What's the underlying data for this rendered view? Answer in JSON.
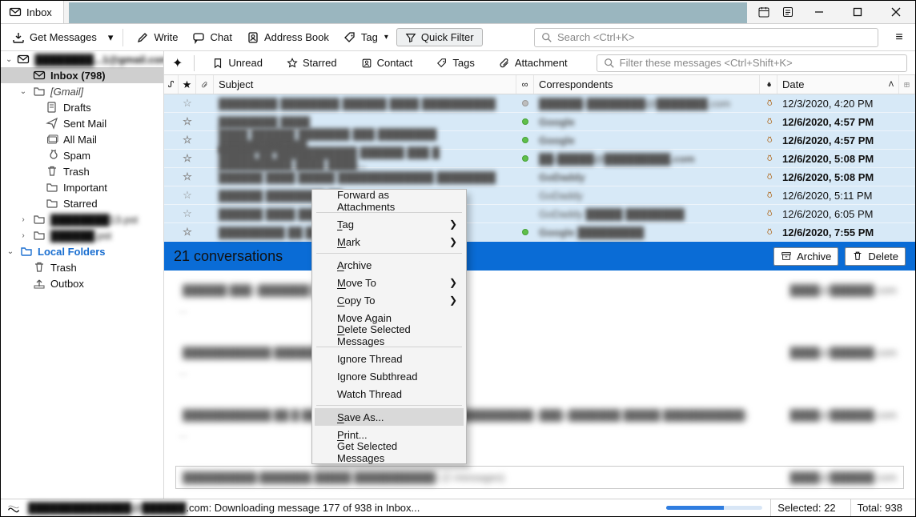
{
  "titlebar": {
    "tab_label": "Inbox",
    "calendar_icon": "calendar-icon",
    "tasks_icon": "tasks-icon"
  },
  "toolbar": {
    "get_messages": "Get Messages",
    "write": "Write",
    "chat": "Chat",
    "address_book": "Address Book",
    "tag": "Tag",
    "quick_filter": "Quick Filter",
    "search_placeholder": "Search <Ctrl+K>"
  },
  "filterbar": {
    "unread": "Unread",
    "starred": "Starred",
    "contact": "Contact",
    "tags": "Tags",
    "attachment": "Attachment",
    "filter_placeholder": "Filter these messages <Ctrl+Shift+K>"
  },
  "sidebar": [
    {
      "indent": 0,
      "twisty": "down",
      "icon": "mail-account-icon",
      "label": "████████...1@gmail.com",
      "bold": true,
      "blur": true
    },
    {
      "indent": 1,
      "twisty": "",
      "icon": "inbox-icon",
      "label": "Inbox (798)",
      "bold": true,
      "selected": true
    },
    {
      "indent": 1,
      "twisty": "down",
      "icon": "folder-icon",
      "label": "[Gmail]",
      "italic": true
    },
    {
      "indent": 2,
      "twisty": "",
      "icon": "drafts-icon",
      "label": "Drafts"
    },
    {
      "indent": 2,
      "twisty": "",
      "icon": "sent-icon",
      "label": "Sent Mail"
    },
    {
      "indent": 2,
      "twisty": "",
      "icon": "allmail-icon",
      "label": "All Mail"
    },
    {
      "indent": 2,
      "twisty": "",
      "icon": "spam-icon",
      "label": "Spam"
    },
    {
      "indent": 2,
      "twisty": "",
      "icon": "trash-icon",
      "label": "Trash"
    },
    {
      "indent": 2,
      "twisty": "",
      "icon": "folder-icon",
      "label": "Important"
    },
    {
      "indent": 2,
      "twisty": "",
      "icon": "folder-icon",
      "label": "Starred"
    },
    {
      "indent": 1,
      "twisty": "right",
      "icon": "folder-icon",
      "label": "████████13.pst",
      "blur": true
    },
    {
      "indent": 1,
      "twisty": "right",
      "icon": "folder-icon",
      "label": "██████.pst",
      "blur": true
    },
    {
      "indent": 0,
      "twisty": "down",
      "icon": "local-folders-icon",
      "label": "Local Folders",
      "blue": true,
      "bold": true
    },
    {
      "indent": 1,
      "twisty": "",
      "icon": "trash-icon",
      "label": "Trash"
    },
    {
      "indent": 1,
      "twisty": "",
      "icon": "outbox-icon",
      "label": "Outbox"
    }
  ],
  "columns": {
    "subject": "Subject",
    "correspondents": "Correspondents",
    "date": "Date"
  },
  "messages": [
    {
      "unread": false,
      "oo": "gray",
      "subject": "████████ ████████ ██████ ████ ██████████",
      "corr": "██████-████████@███████.com",
      "date": "12/3/2020, 4:20 PM"
    },
    {
      "unread": true,
      "oo": "green",
      "subject": "████████ ████",
      "corr": "Google",
      "date": "12/6/2020, 4:57 PM"
    },
    {
      "unread": true,
      "oo": "green",
      "subject": "████ ██████ ███████ ███ ████████ ████████████",
      "corr": "Google",
      "date": "12/6/2020, 4:57 PM"
    },
    {
      "unread": true,
      "oo": "green",
      "subject": "█████ ██ ███████████ ██████ ███ █ ██████████ ████ ████...",
      "corr": "██-█████@█████████.com",
      "date": "12/6/2020, 5:08 PM"
    },
    {
      "unread": true,
      "oo": "",
      "subject": "██████ ████ █████ █████████████ ████████",
      "corr": "GoDaddy",
      "date": "12/6/2020, 5:08 PM"
    },
    {
      "unread": false,
      "oo": "",
      "subject": "██████ ████████ ██",
      "corr": "GoDaddy",
      "date": "12/6/2020, 5:11 PM"
    },
    {
      "unread": false,
      "oo": "",
      "subject": "██████ ████ ██████",
      "corr": "GoDaddy █████ ████████",
      "date": "12/6/2020, 6:05 PM"
    },
    {
      "unread": true,
      "oo": "green",
      "subject": "█████████ ██ ██████",
      "corr": "Google █████████",
      "date": "12/6/2020, 7:55 PM"
    }
  ],
  "summary": {
    "title": "21 conversations",
    "archive": "Archive",
    "delete": "Delete"
  },
  "preview": [
    {
      "subject": "██████ ███ (███████ █████ ███████████)",
      "from": "████@██████.com",
      "boxed": false
    },
    {
      "subject": "████████████ ██████ ███",
      "from": "████@██████.com",
      "boxed": false
    },
    {
      "subject": "████████████ ██ █ ███ ████████████████████████████ (███)(███████ █████ ███████████)",
      "from": "████@██████.com",
      "boxed": false
    },
    {
      "subject": "██████████(███████ █████ ███████████)  (2 messages)",
      "from": "████@██████.com",
      "boxed": true
    }
  ],
  "status": {
    "account": "██████████████@██████",
    "suffix": ".com: Downloading message 177 of 938 in Inbox...",
    "selected_label": "Selected:",
    "selected_value": "22",
    "total_label": "Total:",
    "total_value": "938"
  },
  "context_menu": [
    {
      "type": "item",
      "label": "Forward as Attachments"
    },
    {
      "type": "sep"
    },
    {
      "type": "item",
      "label": "Tag",
      "submenu": true,
      "ul": 0
    },
    {
      "type": "item",
      "label": "Mark",
      "submenu": true,
      "ul": 0
    },
    {
      "type": "sep"
    },
    {
      "type": "item",
      "label": "Archive",
      "ul": 0
    },
    {
      "type": "item",
      "label": "Move To",
      "submenu": true,
      "ul": 0
    },
    {
      "type": "item",
      "label": "Copy To",
      "submenu": true,
      "ul": 0
    },
    {
      "type": "item",
      "label": "Move Again",
      "disabled": true
    },
    {
      "type": "item",
      "label": "Delete Selected Messages",
      "ul": 0
    },
    {
      "type": "sep"
    },
    {
      "type": "item",
      "label": "Ignore Thread"
    },
    {
      "type": "item",
      "label": "Ignore Subthread"
    },
    {
      "type": "item",
      "label": "Watch Thread"
    },
    {
      "type": "sep"
    },
    {
      "type": "item",
      "label": "Save As...",
      "ul": 0,
      "highlight": true
    },
    {
      "type": "item",
      "label": "Print...",
      "ul": 0
    },
    {
      "type": "item",
      "label": "Get Selected Messages",
      "disabled": true
    }
  ]
}
